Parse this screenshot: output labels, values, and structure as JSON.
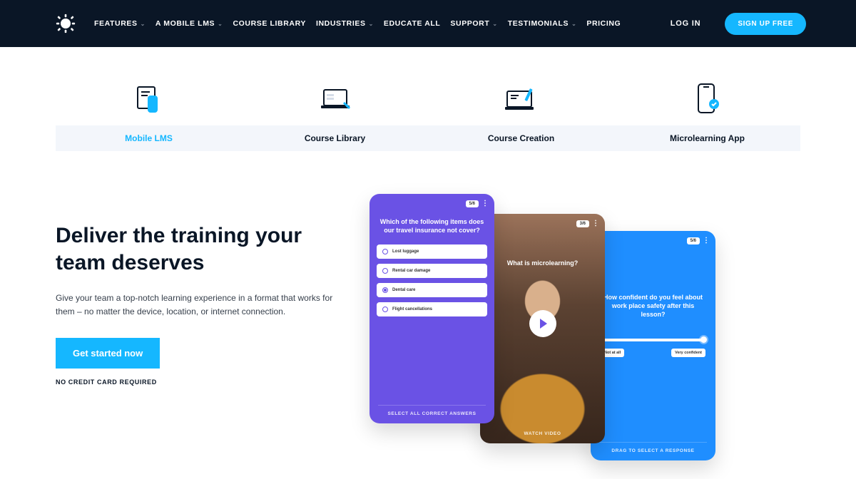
{
  "header": {
    "nav": [
      {
        "label": "FEATURES",
        "dropdown": true
      },
      {
        "label": "A MOBILE LMS",
        "dropdown": true
      },
      {
        "label": "COURSE LIBRARY",
        "dropdown": false
      },
      {
        "label": "INDUSTRIES",
        "dropdown": true
      },
      {
        "label": "EDUCATE ALL",
        "dropdown": false
      },
      {
        "label": "SUPPORT",
        "dropdown": true
      },
      {
        "label": "TESTIMONIALS",
        "dropdown": true
      },
      {
        "label": "PRICING",
        "dropdown": false
      }
    ],
    "login": "LOG IN",
    "signup": "SIGN UP FREE"
  },
  "tabs": [
    {
      "label": "Mobile LMS",
      "active": true
    },
    {
      "label": "Course Library",
      "active": false
    },
    {
      "label": "Course Creation",
      "active": false
    },
    {
      "label": "Microlearning App",
      "active": false
    }
  ],
  "hero": {
    "title": "Deliver the training your team deserves",
    "subtitle": "Give your team a top-notch learning experience in a format that works for them – no matter the device, location, or internet connection.",
    "cta": "Get started now",
    "note": "NO CREDIT CARD REQUIRED"
  },
  "phones": {
    "quiz": {
      "progress": "5/6",
      "question": "Which of the following items does our travel insurance not cover?",
      "options": [
        {
          "label": "Lost luggage",
          "selected": false
        },
        {
          "label": "Rental car damage",
          "selected": false
        },
        {
          "label": "Dental care",
          "selected": true
        },
        {
          "label": "Flight cancellations",
          "selected": false
        }
      ],
      "hint": "SELECT ALL CORRECT ANSWERS"
    },
    "video": {
      "progress": "3/6",
      "question": "What is microlearning?",
      "hint": "WATCH VIDEO"
    },
    "slider": {
      "progress": "5/6",
      "question": "How confident do you feel about work place safety after this lesson?",
      "min_label": "Not at all",
      "max_label": "Very confident",
      "hint": "DRAG TO SELECT A RESPONSE"
    }
  }
}
